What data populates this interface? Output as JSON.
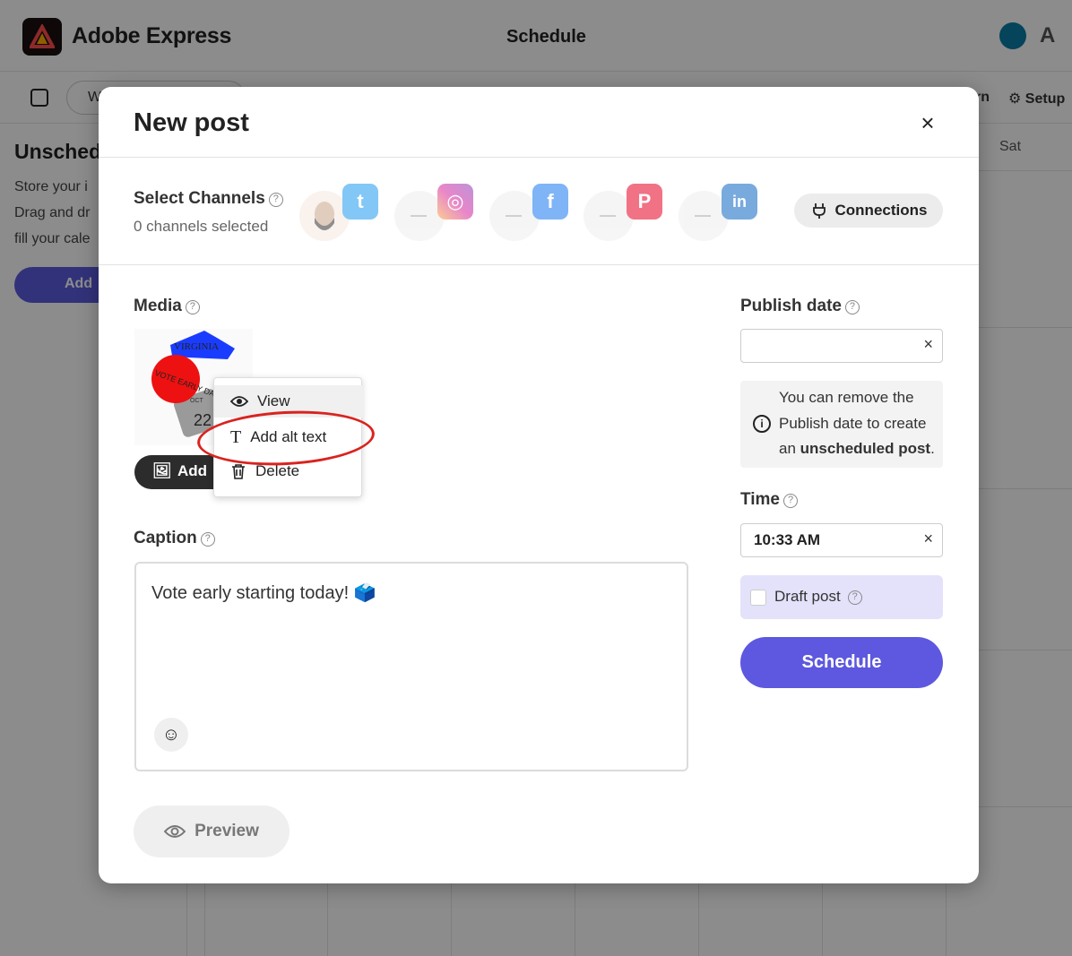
{
  "app": {
    "name": "Adobe Express",
    "page_heading": "Schedule",
    "adobe_mark": "A"
  },
  "subbar": {
    "view_toggle": "W",
    "learn": "rn",
    "setup": "Setup"
  },
  "sidebar": {
    "title": "Unsched",
    "lines": [
      "Store your i",
      "Drag and dr",
      "fill your cale"
    ],
    "add_button": "Add"
  },
  "calendar": {
    "sat_label": "Sat"
  },
  "modal": {
    "title": "New post",
    "close_glyph": "×",
    "channels": {
      "label": "Select Channels",
      "count_text": "0 channels selected",
      "items": [
        {
          "name": "twitter",
          "glyph": "t",
          "color": "#1d9bf0"
        },
        {
          "name": "instagram",
          "glyph": "◎",
          "color": "#d6249f"
        },
        {
          "name": "facebook",
          "glyph": "f",
          "color": "#1877f2"
        },
        {
          "name": "pinterest",
          "glyph": "P",
          "color": "#e60023"
        },
        {
          "name": "linkedin",
          "glyph": "in",
          "color": "#0a66c2"
        }
      ],
      "connections_label": "Connections"
    },
    "media": {
      "label": "Media",
      "add_button": "Add",
      "thumb_text": {
        "state": "VIRGINIA",
        "sticker": "VOTE EARLY DAY",
        "calendar": "22",
        "month": "OCT"
      },
      "context_menu": {
        "view": "View",
        "add_alt_text": "Add alt text",
        "delete": "Delete"
      }
    },
    "caption": {
      "label": "Caption",
      "text": "Vote early starting today! 🗳️"
    },
    "preview_button": "Preview",
    "publish": {
      "label": "Publish date",
      "value": "",
      "info_lines": [
        "You can remove the",
        "Publish date to create"
      ],
      "info_prefix": "an ",
      "info_bold": "unscheduled post",
      "info_suffix": "."
    },
    "time": {
      "label": "Time",
      "value": "10:33 AM"
    },
    "draft": {
      "label": "Draft post",
      "checked": false
    },
    "schedule_button": "Schedule"
  }
}
